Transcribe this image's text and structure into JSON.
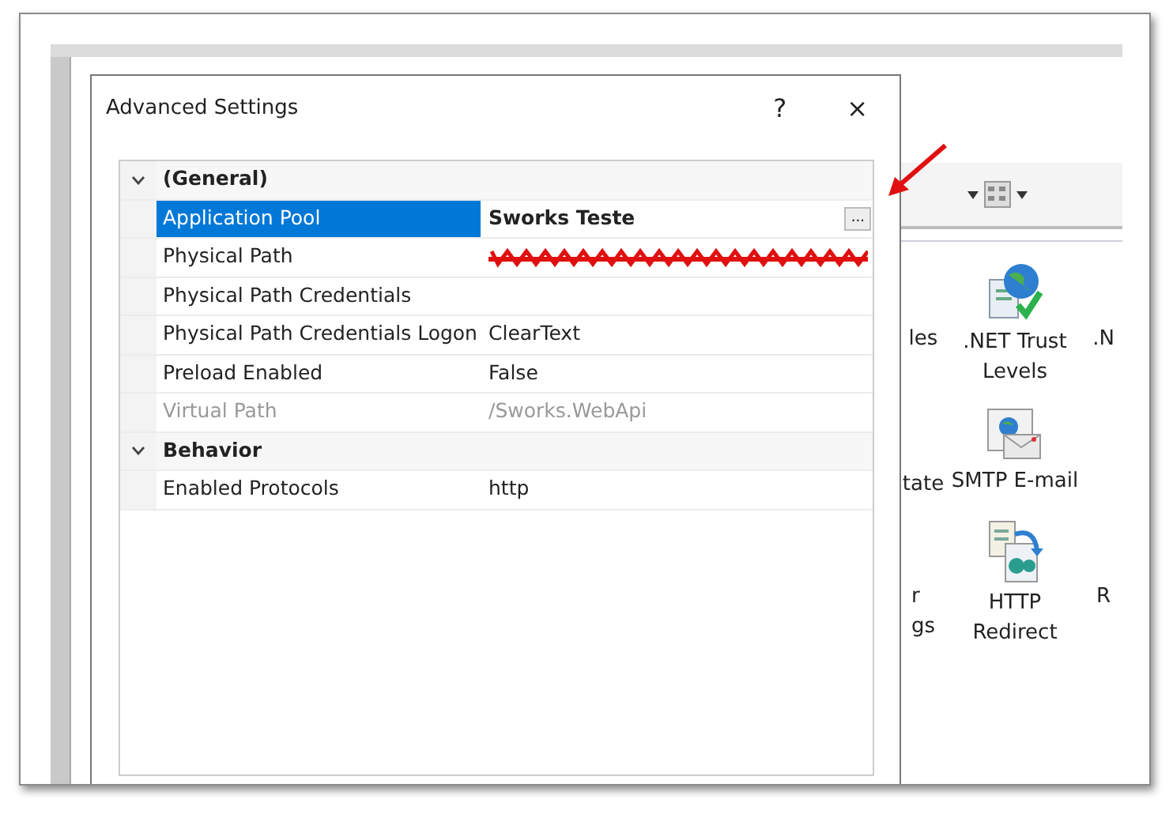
{
  "dialog": {
    "title": "Advanced Settings",
    "help_button": "?",
    "close_button": "×"
  },
  "property_grid": {
    "categories": [
      {
        "name": "(General)",
        "expanded": true,
        "properties": [
          {
            "name": "Application Pool",
            "value": "Sworks Teste",
            "selected": true,
            "modified": true,
            "browse_button": "...",
            "disabled": false,
            "redacted": false
          },
          {
            "name": "Physical Path",
            "selected": false,
            "disabled": false,
            "redacted": true
          },
          {
            "name": "Physical Path Credentials",
            "selected": false,
            "disabled": false,
            "redacted": false
          },
          {
            "name": "Physical Path Credentials Logon",
            "value": "ClearText",
            "selected": false,
            "modified": false,
            "disabled": false,
            "redacted": false
          },
          {
            "name": "Preload Enabled",
            "value": "False",
            "selected": false,
            "modified": false,
            "disabled": false,
            "redacted": false
          },
          {
            "name": "Virtual Path",
            "value": "/Sworks.WebApi",
            "selected": false,
            "modified": false,
            "disabled": true,
            "redacted": false
          }
        ]
      },
      {
        "name": "Behavior",
        "expanded": true,
        "properties": [
          {
            "name": "Enabled Protocols",
            "value": "http",
            "selected": false,
            "modified": false,
            "disabled": false,
            "redacted": false
          }
        ]
      }
    ]
  },
  "background_window": {
    "feature_rows": [
      [
        {
          "kind": "cut",
          "label": "les"
        },
        {
          "kind": "trust",
          "label": ".NET Trust Levels"
        },
        {
          "kind": "cut",
          "label": ".N"
        }
      ],
      [
        {
          "kind": "cut",
          "label": "tate"
        },
        {
          "kind": "mail",
          "label": "SMTP E-mail"
        }
      ],
      [
        {
          "kind": "cut",
          "label": "r\ngs"
        },
        {
          "kind": "redirect",
          "label": "HTTP Redirect"
        },
        {
          "kind": "cut",
          "label": "R"
        }
      ]
    ]
  }
}
